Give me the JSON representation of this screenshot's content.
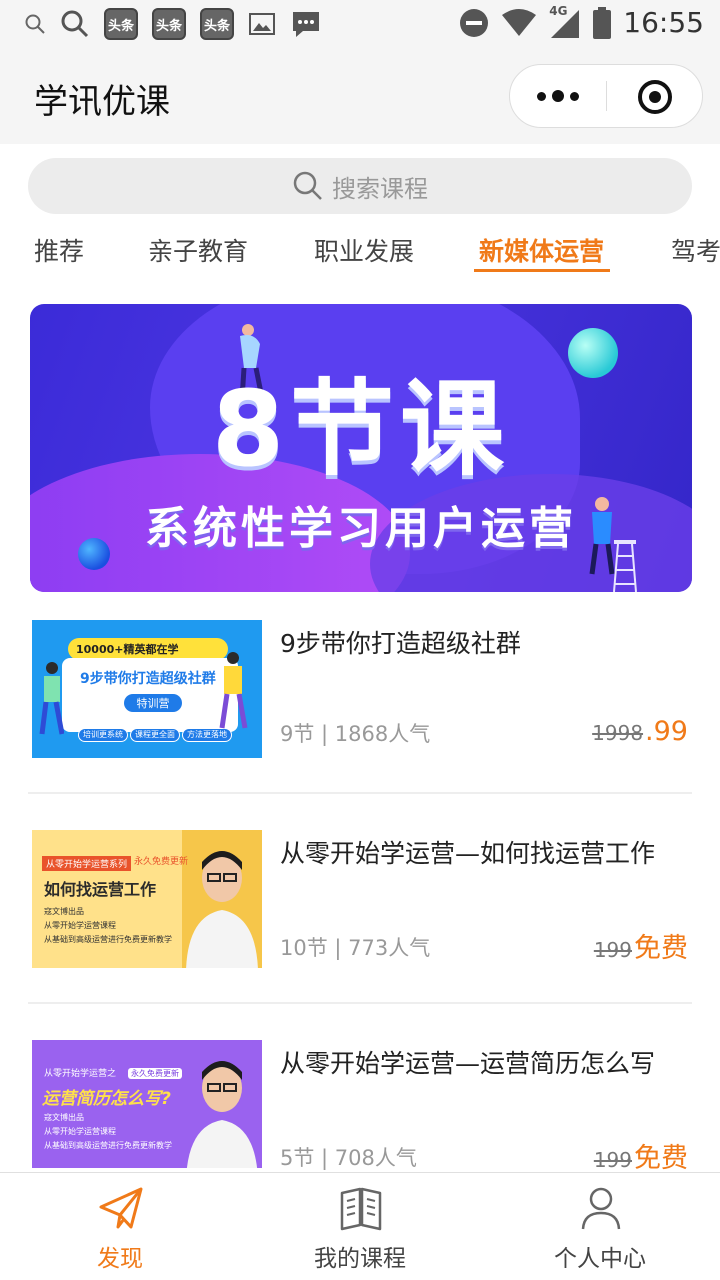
{
  "status_bar": {
    "time": "16:55",
    "toutiao_badges": [
      "头条",
      "头条",
      "头条"
    ],
    "network": "4G",
    "icons": [
      "search-icon",
      "search-icon",
      "toutiao-icon",
      "toutiao-icon",
      "toutiao-icon",
      "image-icon",
      "message-icon",
      "dnd-icon",
      "wifi-icon",
      "signal-icon",
      "battery-icon"
    ]
  },
  "header": {
    "title": "学讯优课",
    "icons": [
      "more-icon",
      "close-miniprogram-icon"
    ]
  },
  "search": {
    "placeholder": "搜索课程",
    "icon": "search-icon"
  },
  "tabs": [
    {
      "label": "推荐",
      "active": false
    },
    {
      "label": "亲子教育",
      "active": false
    },
    {
      "label": "职业发展",
      "active": false
    },
    {
      "label": "新媒体运营",
      "active": true
    },
    {
      "label": "驾考",
      "active": false
    }
  ],
  "banner": {
    "headline": "8节课",
    "subline": "系统性学习用户运营"
  },
  "courses": [
    {
      "title": "9步带你打造超级社群",
      "meta": "9节 | 1868人气",
      "original_price": "1998",
      "price": ".99",
      "thumb": {
        "top_text": "10000+精英都在学",
        "title": "9步带你打造超级社群",
        "button": "特训营",
        "chips": [
          "培训更系统",
          "课程更全面",
          "方法更落地"
        ]
      }
    },
    {
      "title": "从零开始学运营—如何找运营工作",
      "meta": "10节 | 773人气",
      "original_price": "199",
      "price": "免费",
      "thumb": {
        "tag": "从零开始学运营系列",
        "tag2": "永久免费更新",
        "title": "如何找运营工作",
        "lines": [
          "寇文博出品",
          "从零开始学运营课程",
          "从基础到高级运营进行免费更新教学"
        ]
      }
    },
    {
      "title": "从零开始学运营—运营简历怎么写",
      "meta": "5节 | 708人气",
      "original_price": "199",
      "price": "免费",
      "thumb": {
        "tag": "从零开始学运营之",
        "tag2": "永久免费更新",
        "title": "运营简历怎么写?",
        "lines": [
          "寇文博出品",
          "从零开始学运营课程",
          "从基础到高级运营进行免费更新教学"
        ]
      }
    }
  ],
  "bottom_nav": [
    {
      "label": "发现",
      "icon": "paper-plane-icon",
      "active": true
    },
    {
      "label": "我的课程",
      "icon": "book-icon",
      "active": false
    },
    {
      "label": "个人中心",
      "icon": "user-icon",
      "active": false
    }
  ],
  "colors": {
    "accent": "#f07a19",
    "background": "#ffffff",
    "header_bg": "#f5f5f5",
    "banner": "#3b2bd8"
  }
}
